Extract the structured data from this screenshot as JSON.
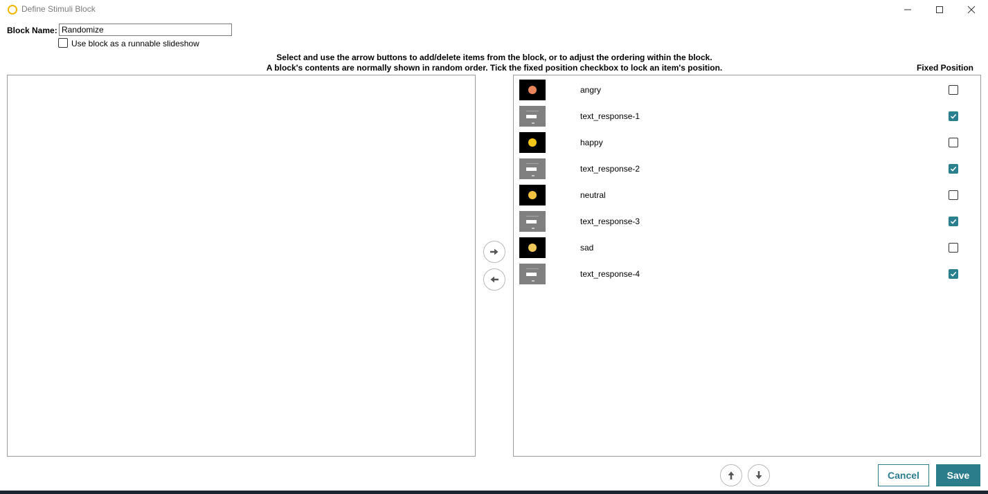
{
  "window": {
    "title": "Define Stimuli Block",
    "icon": "app-ring-icon",
    "controls": [
      "minimize-icon",
      "maximize-icon",
      "close-icon"
    ]
  },
  "form": {
    "block_name_label": "Block Name:",
    "block_name_value": "Randomize",
    "slideshow_label": "Use block as a runnable slideshow",
    "slideshow_checked": false
  },
  "instructions": {
    "line1": "Select and use the arrow buttons to add/delete items from the block, or to adjust the ordering within the block.",
    "line2": "A block's contents are normally shown in random order. Tick the fixed position checkbox to lock an item's position."
  },
  "fixed_position_header": "Fixed Position",
  "available_items": [],
  "block_items": [
    {
      "label": "angry",
      "thumb": "emoji",
      "emoji_color": "#e8845a",
      "fixed": false
    },
    {
      "label": "text_response-1",
      "thumb": "text",
      "fixed": true
    },
    {
      "label": "happy",
      "thumb": "emoji",
      "emoji_color": "#f5c518",
      "fixed": false
    },
    {
      "label": "text_response-2",
      "thumb": "text",
      "fixed": true
    },
    {
      "label": "neutral",
      "thumb": "emoji",
      "emoji_color": "#f2c240",
      "fixed": false
    },
    {
      "label": "text_response-3",
      "thumb": "text",
      "fixed": true
    },
    {
      "label": "sad",
      "thumb": "emoji",
      "emoji_color": "#f0c85a",
      "fixed": false
    },
    {
      "label": "text_response-4",
      "thumb": "text",
      "fixed": true
    }
  ],
  "buttons": {
    "add_icon": "arrow-right-icon",
    "remove_icon": "arrow-left-icon",
    "move_up_icon": "arrow-up-icon",
    "move_down_icon": "arrow-down-icon",
    "cancel": "Cancel",
    "save": "Save"
  },
  "colors": {
    "accent": "#2b7d8c",
    "checkbox_checked": "#2b8090",
    "app_icon": "#f2b600"
  }
}
